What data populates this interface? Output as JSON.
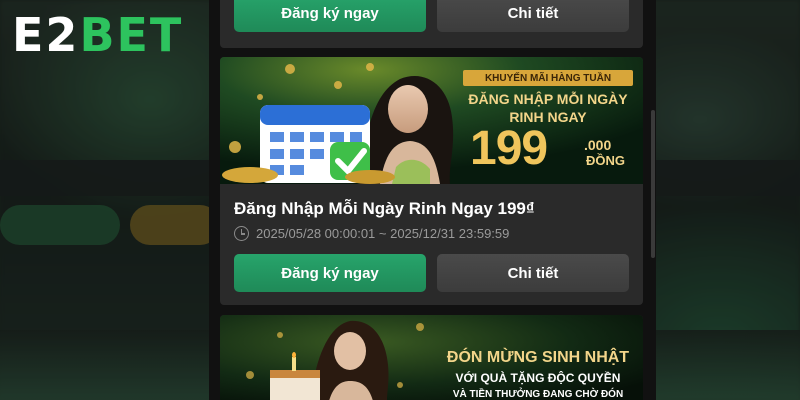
{
  "brand": {
    "logo_part1": "E2",
    "logo_part2": "BET"
  },
  "cards": [
    {
      "register_label": "Đăng ký ngay",
      "detail_label": "Chi tiết"
    },
    {
      "banner": {
        "tag": "KHUYẾN MÃI HÀNG TUẦN",
        "line1": "ĐĂNG NHẬP MỖI NGÀY",
        "line2": "RINH NGAY",
        "amount": "199",
        "amount_suffix": ".000",
        "currency": "ĐỒNG"
      },
      "title": "Đăng Nhập Mỗi Ngày Rinh Ngay 199₫",
      "date_range": "2025/05/28 00:00:01 ~ 2025/12/31 23:59:59",
      "register_label": "Đăng ký ngay",
      "detail_label": "Chi tiết"
    },
    {
      "banner": {
        "line1": "ĐÓN MỪNG SINH NHẬT",
        "line2": "VỚI QUÀ TẶNG ĐỘC QUYỀN",
        "line3": "VÀ TIỀN THƯỞNG ĐANG CHỜ ĐÓN"
      }
    }
  ],
  "colors": {
    "primary_green": "#1f8a58",
    "logo_green": "#2dc35e",
    "gold_text": "#f3d58a",
    "panel_bg": "#111111",
    "card_bg": "#2a2a2a"
  },
  "icons": {
    "date": "clock-icon",
    "banner1": "calendar-check-icon",
    "banner2": "birthday-cake-icon"
  }
}
